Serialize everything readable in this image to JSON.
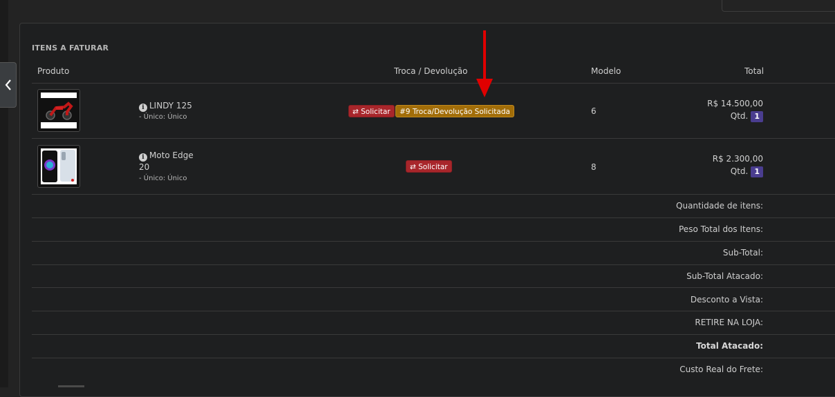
{
  "section": {
    "title": "ITENS A FATURAR"
  },
  "table": {
    "headers": {
      "produto": "Produto",
      "troca": "Troca / Devolução",
      "modelo": "Modelo",
      "total": "Total"
    },
    "rows": [
      {
        "name": "LINDY 125",
        "variant": "- Único: Único",
        "solicitar_label": "⇄ Solicitar",
        "status_badge": "#9 Troca/Devolução Solicitada",
        "modelo": "6",
        "price": "R$ 14.500,00",
        "qtd_label": "Qtd.",
        "qtd": "1"
      },
      {
        "name_line1": "Moto Edge",
        "name_line2": "20",
        "variant": "- Único: Único",
        "solicitar_label": "⇄ Solicitar",
        "modelo": "8",
        "price": "R$ 2.300,00",
        "qtd_label": "Qtd.",
        "qtd": "1"
      }
    ]
  },
  "summary": [
    "Quantidade de itens:",
    "Peso Total dos Itens:",
    "Sub-Total:",
    "Sub-Total Atacado:",
    "Desconto a Vista:",
    "RETIRE NA LOJA:",
    "Total Atacado:",
    "Custo Real do Frete:"
  ],
  "colors": {
    "accent_red": "#a8262b",
    "warning_badge": "#a26d08",
    "qty_badge": "#4a3d8f",
    "annotation_arrow": "#e00000"
  }
}
